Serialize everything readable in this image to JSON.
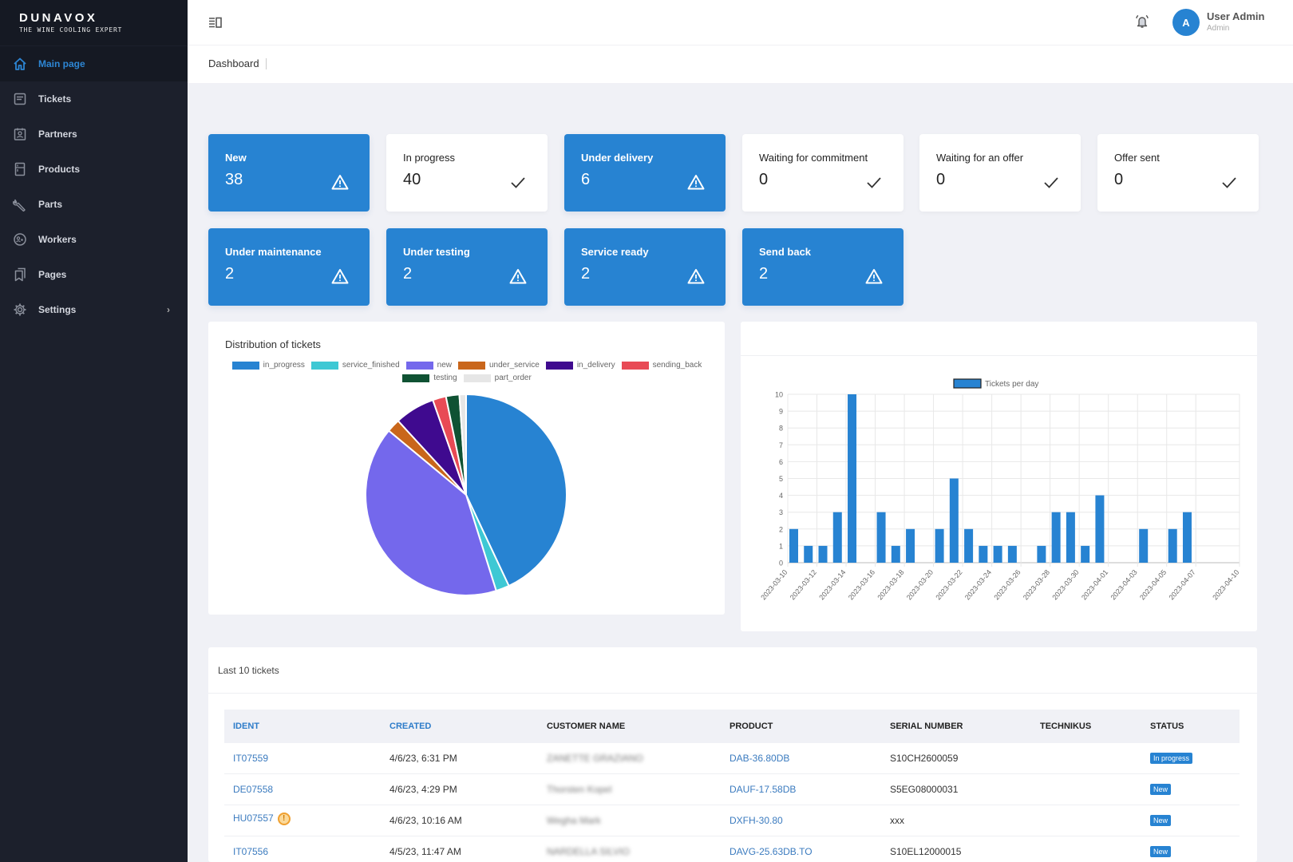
{
  "brand": {
    "name": "DUNAVOX",
    "tagline": "THE WINE COOLING EXPERT"
  },
  "sidebar": {
    "items": [
      {
        "label": "Main page",
        "icon": "home-icon",
        "active": true
      },
      {
        "label": "Tickets",
        "icon": "ticket-icon"
      },
      {
        "label": "Partners",
        "icon": "partner-icon"
      },
      {
        "label": "Products",
        "icon": "fridge-icon"
      },
      {
        "label": "Parts",
        "icon": "wrench-icon"
      },
      {
        "label": "Workers",
        "icon": "worker-icon"
      },
      {
        "label": "Pages",
        "icon": "pages-icon"
      },
      {
        "label": "Settings",
        "icon": "gear-icon",
        "has_submenu": true
      }
    ]
  },
  "header": {
    "user_name": "User Admin",
    "user_role": "Admin",
    "avatar_initial": "A",
    "breadcrumb": "Dashboard"
  },
  "stats": [
    {
      "label": "New",
      "value": "38",
      "style": "blue",
      "icon": "warning-icon"
    },
    {
      "label": "In progress",
      "value": "40",
      "style": "white",
      "icon": "check-icon"
    },
    {
      "label": "Under delivery",
      "value": "6",
      "style": "blue",
      "icon": "warning-icon"
    },
    {
      "label": "Waiting for commitment",
      "value": "0",
      "style": "white",
      "icon": "check-icon"
    },
    {
      "label": "Waiting for an offer",
      "value": "0",
      "style": "white",
      "icon": "check-icon"
    },
    {
      "label": "Offer sent",
      "value": "0",
      "style": "white",
      "icon": "check-icon"
    },
    {
      "label": "Under maintenance",
      "value": "2",
      "style": "blue",
      "icon": "warning-icon"
    },
    {
      "label": "Under testing",
      "value": "2",
      "style": "blue",
      "icon": "warning-icon"
    },
    {
      "label": "Service ready",
      "value": "2",
      "style": "blue",
      "icon": "warning-icon"
    },
    {
      "label": "Send back",
      "value": "2",
      "style": "blue",
      "icon": "warning-icon"
    }
  ],
  "colors": {
    "primary": "#2783d2",
    "sidebar_bg": "#1c202c",
    "page_bg": "#f0f1f6"
  },
  "chart_data": [
    {
      "type": "pie",
      "title": "Distribution of tickets",
      "legend_position": "top",
      "categories": [
        "in_progress",
        "service_finished",
        "new",
        "under_service",
        "in_delivery",
        "sending_back",
        "testing",
        "part_order"
      ],
      "values": [
        40,
        2,
        38,
        2,
        6,
        2,
        2,
        1
      ],
      "colors": [
        "#2783d2",
        "#3ec8d4",
        "#7468ec",
        "#c9661b",
        "#3f0a8f",
        "#e84a55",
        "#0f5233",
        "#e6e6e6"
      ]
    },
    {
      "type": "bar",
      "title": "",
      "legend": [
        "Tickets per day"
      ],
      "legend_position": "top",
      "xlabel": "",
      "ylabel": "",
      "ylim": [
        0,
        10
      ],
      "y_ticks": [
        0,
        1,
        2,
        3,
        4,
        5,
        6,
        7,
        8,
        9,
        10
      ],
      "x_range": [
        "2023-03-10",
        "2023-04-10"
      ],
      "x_ticks": [
        "2023-03-10",
        "2023-03-12",
        "2023-03-14",
        "2023-03-16",
        "2023-03-18",
        "2023-03-20",
        "2023-03-22",
        "2023-03-24",
        "2023-03-26",
        "2023-03-28",
        "2023-03-30",
        "2023-04-01",
        "2023-04-03",
        "2023-04-05",
        "2023-04-07",
        "2023-04-10"
      ],
      "grid": true,
      "color": "#2783d2",
      "series": [
        {
          "name": "Tickets per day",
          "x": [
            "2023-03-10",
            "2023-03-11",
            "2023-03-12",
            "2023-03-13",
            "2023-03-14",
            "2023-03-16",
            "2023-03-17",
            "2023-03-18",
            "2023-03-20",
            "2023-03-21",
            "2023-03-22",
            "2023-03-23",
            "2023-03-24",
            "2023-03-25",
            "2023-03-27",
            "2023-03-28",
            "2023-03-29",
            "2023-03-30",
            "2023-03-31",
            "2023-04-03",
            "2023-04-05",
            "2023-04-06"
          ],
          "values": [
            2,
            1,
            1,
            3,
            10,
            3,
            1,
            2,
            2,
            5,
            2,
            1,
            1,
            1,
            1,
            3,
            3,
            1,
            4,
            2,
            2,
            3
          ]
        }
      ]
    }
  ],
  "tickets": {
    "title": "Last 10 tickets",
    "columns": [
      "IDENT",
      "CREATED",
      "CUSTOMER NAME",
      "PRODUCT",
      "SERIAL NUMBER",
      "TECHNIKUS",
      "STATUS"
    ],
    "rows": [
      {
        "ident": "IT07559",
        "warning": false,
        "created": "4/6/23, 6:31 PM",
        "customer": "ZANETTE GRAZIANO",
        "product": "DAB-36.80DB",
        "serial": "S10CH2600059",
        "technikus": "",
        "status": "In progress"
      },
      {
        "ident": "DE07558",
        "warning": false,
        "created": "4/6/23, 4:29 PM",
        "customer": "Thorsten Kopel",
        "product": "DAUF-17.58DB",
        "serial": "S5EG08000031",
        "technikus": "",
        "status": "New"
      },
      {
        "ident": "HU07557",
        "warning": true,
        "created": "4/6/23, 10:16 AM",
        "customer": "Wegha Mark",
        "product": "DXFH-30.80",
        "serial": "xxx",
        "technikus": "",
        "status": "New"
      },
      {
        "ident": "IT07556",
        "warning": false,
        "created": "4/5/23, 11:47 AM",
        "customer": "NARDELLA SILVIO",
        "product": "DAVG-25.63DB.TO",
        "serial": "S10EL12000015",
        "technikus": "",
        "status": "New"
      }
    ]
  }
}
